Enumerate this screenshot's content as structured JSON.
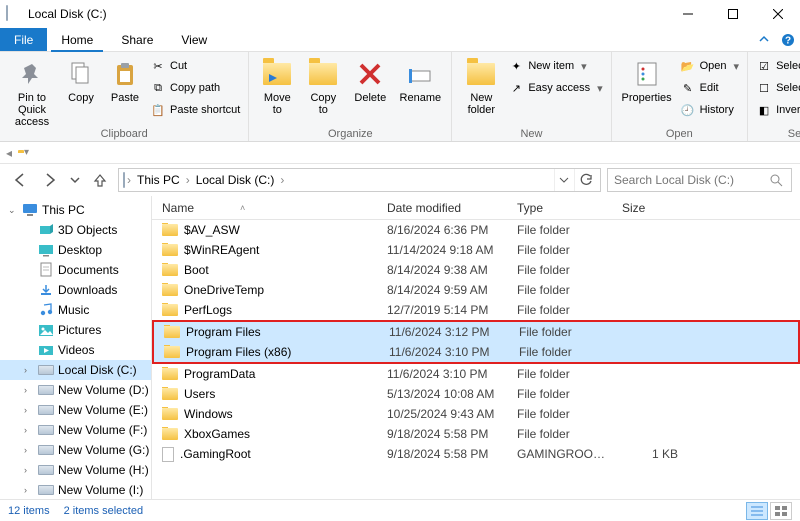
{
  "window": {
    "title": "Local Disk (C:)"
  },
  "menu": {
    "file": "File",
    "home": "Home",
    "share": "Share",
    "view": "View"
  },
  "ribbon": {
    "clipboard": {
      "label": "Clipboard",
      "pin": "Pin to Quick\naccess",
      "copy": "Copy",
      "paste": "Paste",
      "cut": "Cut",
      "copy_path": "Copy path",
      "paste_shortcut": "Paste shortcut"
    },
    "organize": {
      "label": "Organize",
      "move_to": "Move\nto",
      "copy_to": "Copy\nto",
      "delete": "Delete",
      "rename": "Rename"
    },
    "new": {
      "label": "New",
      "new_folder": "New\nfolder",
      "new_item": "New item",
      "easy_access": "Easy access"
    },
    "open": {
      "label": "Open",
      "properties": "Properties",
      "open": "Open",
      "edit": "Edit",
      "history": "History"
    },
    "select": {
      "label": "Select",
      "select_all": "Select all",
      "select_none": "Select none",
      "invert": "Invert selection"
    }
  },
  "breadcrumb": {
    "this_pc": "This PC",
    "drive": "Local Disk (C:)"
  },
  "search": {
    "placeholder": "Search Local Disk (C:)"
  },
  "sidebar": {
    "this_pc": "This PC",
    "items": [
      "3D Objects",
      "Desktop",
      "Documents",
      "Downloads",
      "Music",
      "Pictures",
      "Videos",
      "Local Disk (C:)",
      "New Volume (D:)",
      "New Volume (E:)",
      "New Volume (F:)",
      "New Volume (G:)",
      "New Volume (H:)",
      "New Volume (I:)"
    ]
  },
  "columns": {
    "name": "Name",
    "date": "Date modified",
    "type": "Type",
    "size": "Size"
  },
  "files": [
    {
      "name": "$AV_ASW",
      "date": "8/16/2024 6:36 PM",
      "type": "File folder",
      "size": "",
      "icon": "folder"
    },
    {
      "name": "$WinREAgent",
      "date": "11/14/2024 9:18 AM",
      "type": "File folder",
      "size": "",
      "icon": "folder"
    },
    {
      "name": "Boot",
      "date": "8/14/2024 9:38 AM",
      "type": "File folder",
      "size": "",
      "icon": "folder"
    },
    {
      "name": "OneDriveTemp",
      "date": "8/14/2024 9:59 AM",
      "type": "File folder",
      "size": "",
      "icon": "folder"
    },
    {
      "name": "PerfLogs",
      "date": "12/7/2019 5:14 PM",
      "type": "File folder",
      "size": "",
      "icon": "folder"
    },
    {
      "name": "Program Files",
      "date": "11/6/2024 3:12 PM",
      "type": "File folder",
      "size": "",
      "icon": "folder",
      "selected": true,
      "hl_start": true
    },
    {
      "name": "Program Files (x86)",
      "date": "11/6/2024 3:10 PM",
      "type": "File folder",
      "size": "",
      "icon": "folder",
      "selected": true,
      "hl_end": true
    },
    {
      "name": "ProgramData",
      "date": "11/6/2024 3:10 PM",
      "type": "File folder",
      "size": "",
      "icon": "folder"
    },
    {
      "name": "Users",
      "date": "5/13/2024 10:08 AM",
      "type": "File folder",
      "size": "",
      "icon": "folder"
    },
    {
      "name": "Windows",
      "date": "10/25/2024 9:43 AM",
      "type": "File folder",
      "size": "",
      "icon": "folder"
    },
    {
      "name": "XboxGames",
      "date": "9/18/2024 5:58 PM",
      "type": "File folder",
      "size": "",
      "icon": "folder"
    },
    {
      "name": ".GamingRoot",
      "date": "9/18/2024 5:58 PM",
      "type": "GAMINGROOT File",
      "size": "1 KB",
      "icon": "file"
    }
  ],
  "status": {
    "items": "12 items",
    "selected": "2 items selected"
  }
}
